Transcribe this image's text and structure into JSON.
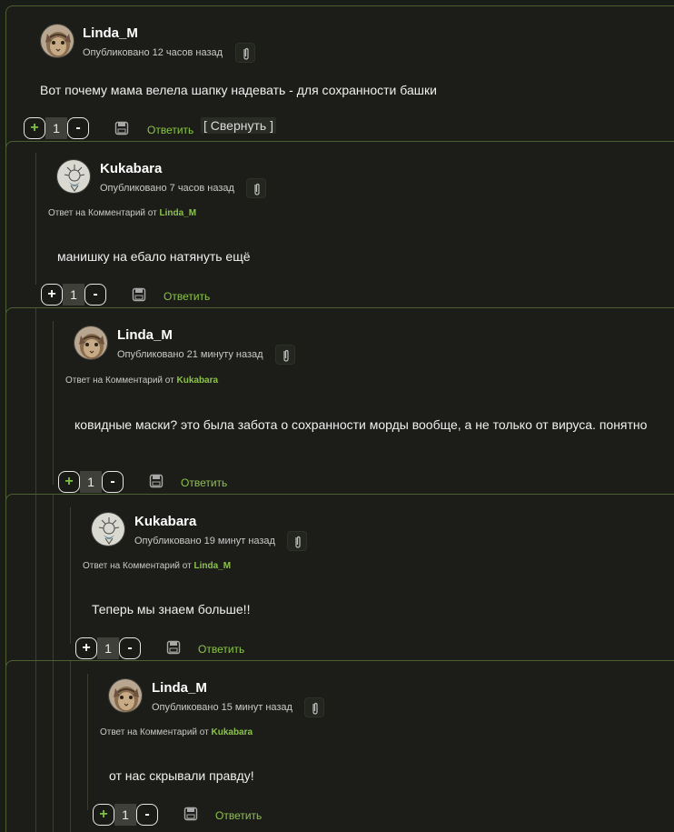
{
  "icons": {
    "clip": "paperclip-icon",
    "save": "save-icon"
  },
  "colors": {
    "background": "#1a1c18",
    "accent": "#8bc34a",
    "border": "#4d5f33"
  },
  "comments": [
    {
      "author": "Linda_M",
      "published": "Опубликовано 12 часов назад",
      "reply_prefix": "",
      "reply_to": "",
      "text": "Вот почему мама велела шапку надевать - для сохранности башки",
      "votes": "1",
      "plus": "+",
      "minus": "-",
      "reply_label": "Ответить",
      "collapse_label": "[ Свернуть ]"
    },
    {
      "author": "Kukabara",
      "published": "Опубликовано 7 часов назад",
      "reply_prefix": "Ответ на Комментарий от ",
      "reply_to": "Linda_M",
      "text": "манишку на ебало натянуть ещё",
      "votes": "1",
      "plus": "+",
      "minus": "-",
      "reply_label": "Ответить"
    },
    {
      "author": "Linda_M",
      "published": "Опубликовано 21 минуту назад",
      "reply_prefix": "Ответ на Комментарий от ",
      "reply_to": "Kukabara",
      "text": "ковидные маски? это была забота о сохранности морды вообще, а не только от вируса. понятно",
      "votes": "1",
      "plus": "+",
      "minus": "-",
      "reply_label": "Ответить"
    },
    {
      "author": "Kukabara",
      "published": "Опубликовано 19 минут назад",
      "reply_prefix": "Ответ на Комментарий от ",
      "reply_to": "Linda_M",
      "text": "Теперь мы знаем больше!!",
      "votes": "1",
      "plus": "+",
      "minus": "-",
      "reply_label": "Ответить"
    },
    {
      "author": "Linda_M",
      "published": "Опубликовано 15 минут назад",
      "reply_prefix": "Ответ на Комментарий от ",
      "reply_to": "Kukabara",
      "text": "от нас скрывали правду!",
      "votes": "1",
      "plus": "+",
      "minus": "-",
      "reply_label": "Ответить"
    }
  ]
}
